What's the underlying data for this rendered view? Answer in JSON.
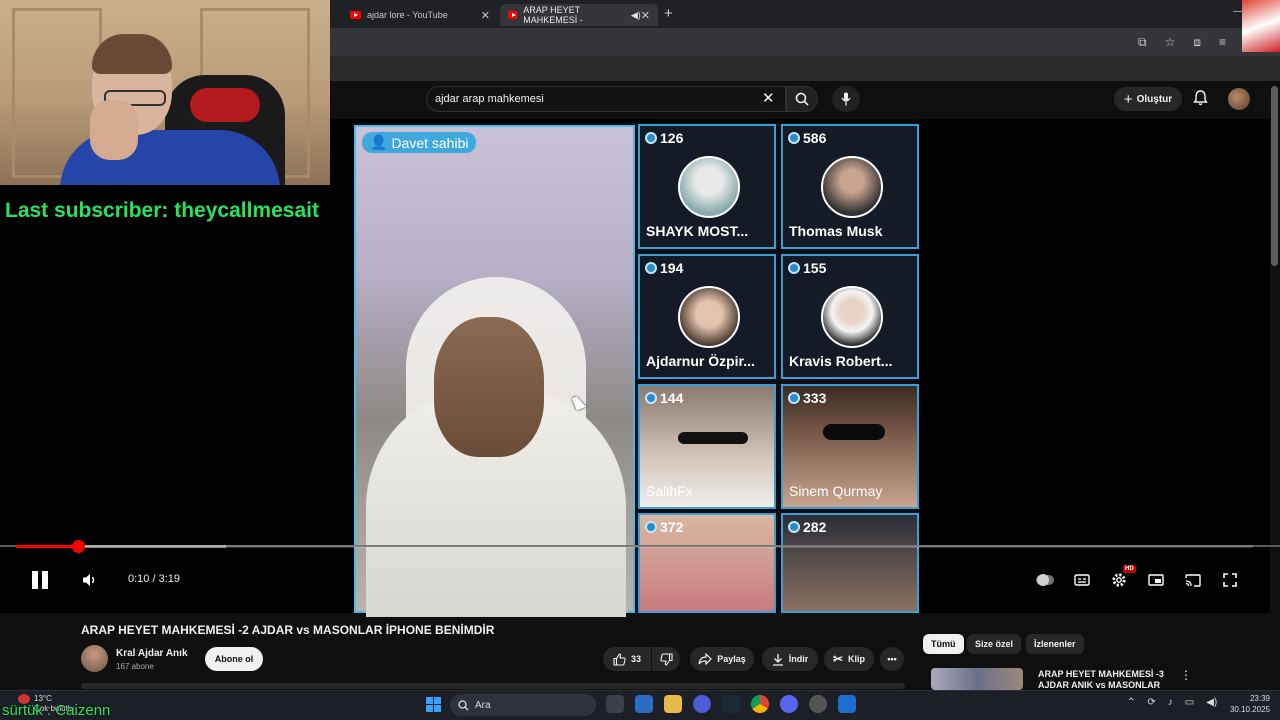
{
  "browser": {
    "tabs": [
      {
        "label": "ajdar lore - YouTube",
        "close": "✕"
      },
      {
        "label": "ARAP HEYET MAHKEMESİ -",
        "close": "✕"
      }
    ],
    "new_tab": "+"
  },
  "youtube": {
    "search": {
      "value": "ajdar arap mahkemesi",
      "clear": "✕"
    },
    "create_label": "Oluştur"
  },
  "video": {
    "host_badge": "Davet sahibi",
    "tiles": [
      {
        "count": "126",
        "name": "SHAYK MOST..."
      },
      {
        "count": "586",
        "name": "Thomas Musk"
      },
      {
        "count": "194",
        "name": "Ajdarnur Özpir..."
      },
      {
        "count": "155",
        "name": "Kravis Robert..."
      },
      {
        "count": "144",
        "name": "SalihFx"
      },
      {
        "count": "333",
        "name": "Sinem Qurmay"
      },
      {
        "count": "372",
        "name": ""
      },
      {
        "count": "282",
        "name": ""
      }
    ],
    "progress": {
      "current_seconds": 10,
      "duration_seconds": 199,
      "buffered_fraction": 0.17
    },
    "timecode": "0:10 / 3:19",
    "hd_badge": "HD",
    "accent_color": "#ff0000"
  },
  "watch": {
    "title": "ARAP HEYET MAHKEMESİ -2 AJDAR vs MASONLAR İPHONE BENİMDİR",
    "channel": {
      "name": "Kral Ajdar Anık",
      "subs": "167 abone"
    },
    "subscribe": "Abone ol",
    "likes": "33",
    "share": "Paylaş",
    "download": "İndir",
    "clip": "Klip",
    "more": "•••"
  },
  "sidebar": {
    "chips": [
      "Tümü",
      "Size özel",
      "İzlenenler"
    ],
    "rec_title": "ARAP HEYET MAHKEMESİ -3 AJDAR ANIK vs MASONLAR"
  },
  "stream_overlay": {
    "last_subscriber": "Last subscriber: theycallmesait",
    "bottom_text": "sürtük : Caizenn"
  },
  "taskbar": {
    "weather_temp": "13°C",
    "weather_desc": "Çok bulutlu",
    "search_label": "Ara",
    "time": "23:39",
    "date": "30.10.2025"
  }
}
